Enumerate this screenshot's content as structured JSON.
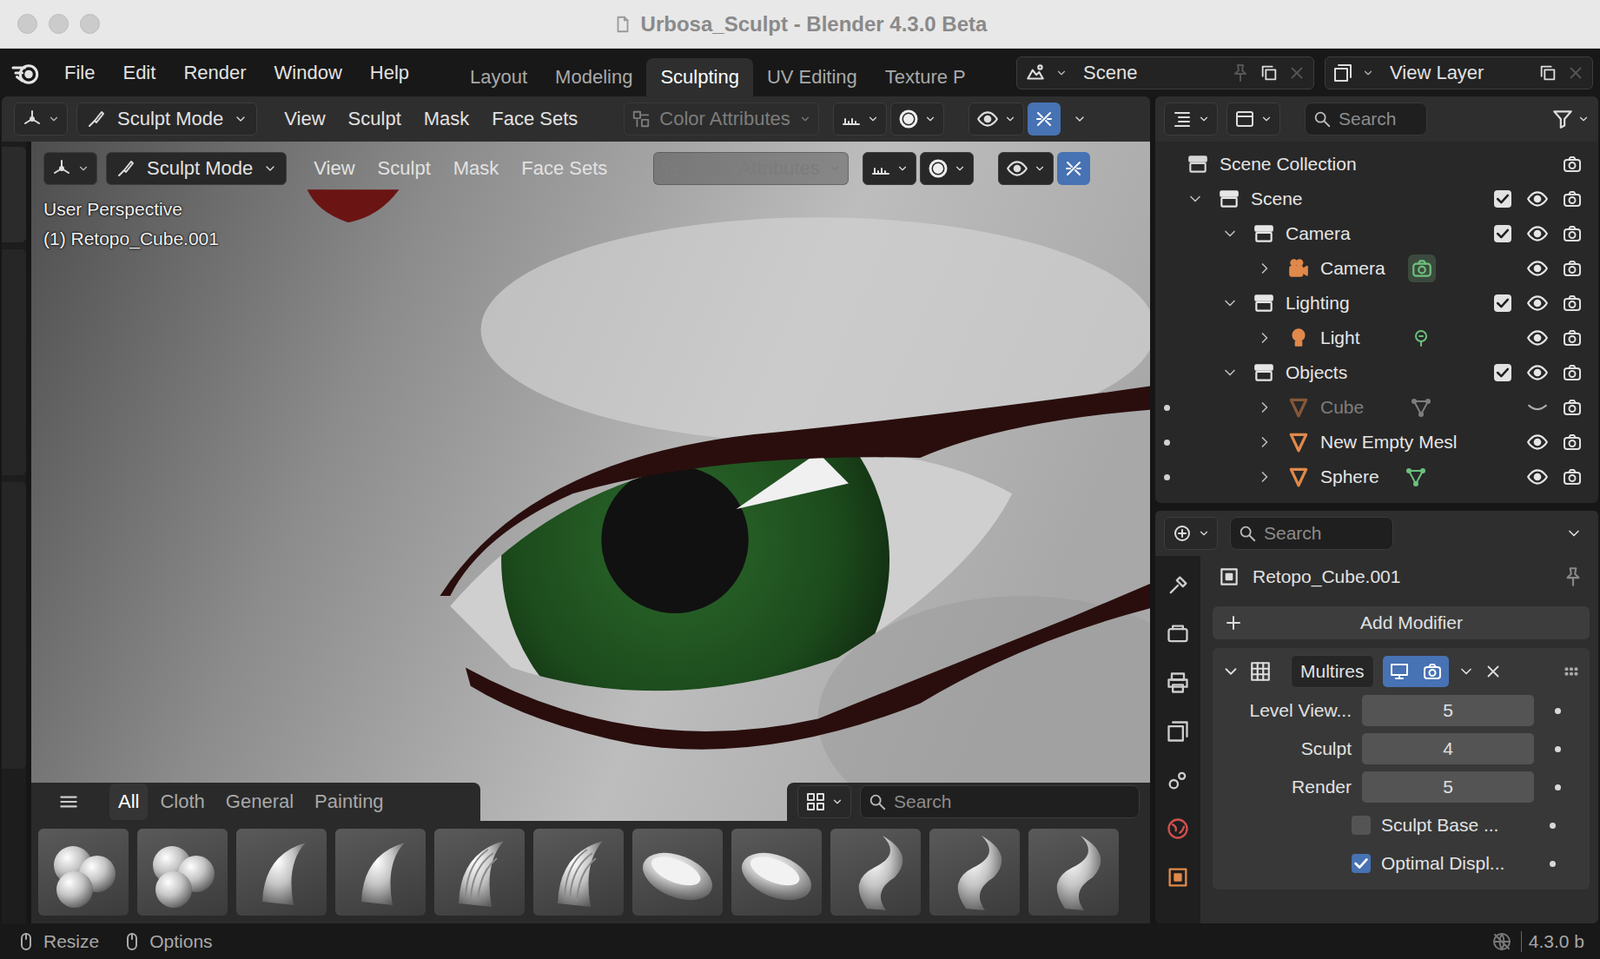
{
  "window": {
    "title": "Urbosa_Sculpt - Blender 4.3.0 Beta"
  },
  "menu": [
    "File",
    "Edit",
    "Render",
    "Window",
    "Help"
  ],
  "workspaces": [
    {
      "label": "Layout",
      "selected": false
    },
    {
      "label": "Modeling",
      "selected": false
    },
    {
      "label": "Sculpting",
      "selected": true
    },
    {
      "label": "UV Editing",
      "selected": false
    },
    {
      "label": "Texture P",
      "selected": false
    }
  ],
  "scene": {
    "name": "Scene"
  },
  "view_layer": {
    "name": "View Layer"
  },
  "viewport_headers": [
    {
      "mode": "Sculpt Mode",
      "menus": [
        "View",
        "Sculpt",
        "Mask",
        "Face Sets"
      ],
      "color_attributes": {
        "label": "Color Attributes",
        "disabled": true
      },
      "mirror_active": true
    },
    {
      "mode": "Sculpt Mode",
      "menus": [
        "View",
        "Sculpt",
        "Mask",
        "Face Sets"
      ],
      "color_attributes": {
        "label": "Color Attributes",
        "disabled": true
      },
      "mirror_active": true
    }
  ],
  "overlay": {
    "perspective": "User Perspective",
    "object": "(1) Retopo_Cube.001"
  },
  "asset_shelf": {
    "tabs": [
      {
        "label": "All",
        "selected": true
      },
      {
        "label": "Cloth",
        "selected": false
      },
      {
        "label": "General",
        "selected": false
      },
      {
        "label": "Painting",
        "selected": false
      }
    ],
    "search": {
      "placeholder": "Search"
    },
    "brushes": [
      {
        "kind": "blobs"
      },
      {
        "kind": "blobs"
      },
      {
        "kind": "draw"
      },
      {
        "kind": "draw"
      },
      {
        "kind": "clay"
      },
      {
        "kind": "clay"
      },
      {
        "kind": "flatten"
      },
      {
        "kind": "flatten"
      },
      {
        "kind": "snake"
      },
      {
        "kind": "snake"
      },
      {
        "kind": "snake"
      }
    ]
  },
  "outliner": {
    "search": {
      "placeholder": "Search"
    },
    "items": [
      {
        "label": "Scene Collection",
        "depth": 0,
        "kind": "scene_collection",
        "mode_dot": false
      },
      {
        "label": "Scene",
        "depth": 1,
        "kind": "collection",
        "expanded": true,
        "checked": true,
        "visible": true,
        "mode_dot": false
      },
      {
        "label": "Camera",
        "depth": 2,
        "kind": "collection",
        "expanded": true,
        "checked": true,
        "visible": true,
        "mode_dot": false
      },
      {
        "label": "Camera",
        "depth": 3,
        "kind": "camera",
        "expanded": false,
        "visible": true,
        "data_shown": true,
        "mode_dot": false
      },
      {
        "label": "Lighting",
        "depth": 2,
        "kind": "collection",
        "expanded": true,
        "checked": true,
        "visible": true,
        "mode_dot": false
      },
      {
        "label": "Light",
        "depth": 3,
        "kind": "light",
        "expanded": false,
        "visible": true,
        "data_shown": true,
        "mode_dot": false
      },
      {
        "label": "Objects",
        "depth": 2,
        "kind": "collection",
        "expanded": true,
        "checked": true,
        "visible": true,
        "mode_dot": false
      },
      {
        "label": "Cube",
        "depth": 3,
        "kind": "mesh",
        "expanded": false,
        "visible": false,
        "disabled": true,
        "data_shown": true,
        "mode_dot": true
      },
      {
        "label": "New Empty Mesl",
        "depth": 3,
        "kind": "mesh",
        "expanded": false,
        "visible": true,
        "disabled": false,
        "data_shown": false,
        "mode_dot": true
      },
      {
        "label": "Sphere",
        "depth": 3,
        "kind": "mesh",
        "expanded": false,
        "visible": true,
        "disabled": false,
        "data_shown": true,
        "mode_dot": true
      }
    ]
  },
  "properties": {
    "search": {
      "placeholder": "Search"
    },
    "object": "Retopo_Cube.001",
    "add_modifier": "Add Modifier",
    "modifier": {
      "name": "Multires",
      "expanded": true,
      "show_viewport": true,
      "show_render": true,
      "fields": [
        {
          "kind": "number",
          "label": "Level View...",
          "value": "5"
        },
        {
          "kind": "number",
          "label": "Sculpt",
          "value": "4"
        },
        {
          "kind": "number",
          "label": "Render",
          "value": "5"
        },
        {
          "kind": "checkbox",
          "label": "Sculpt Base ...",
          "checked": false
        },
        {
          "kind": "checkbox",
          "label": "Optimal Displ...",
          "checked": true
        }
      ]
    }
  },
  "status_bar": {
    "items": [
      "Resize",
      "Options"
    ],
    "version": "4.3.0 b"
  }
}
